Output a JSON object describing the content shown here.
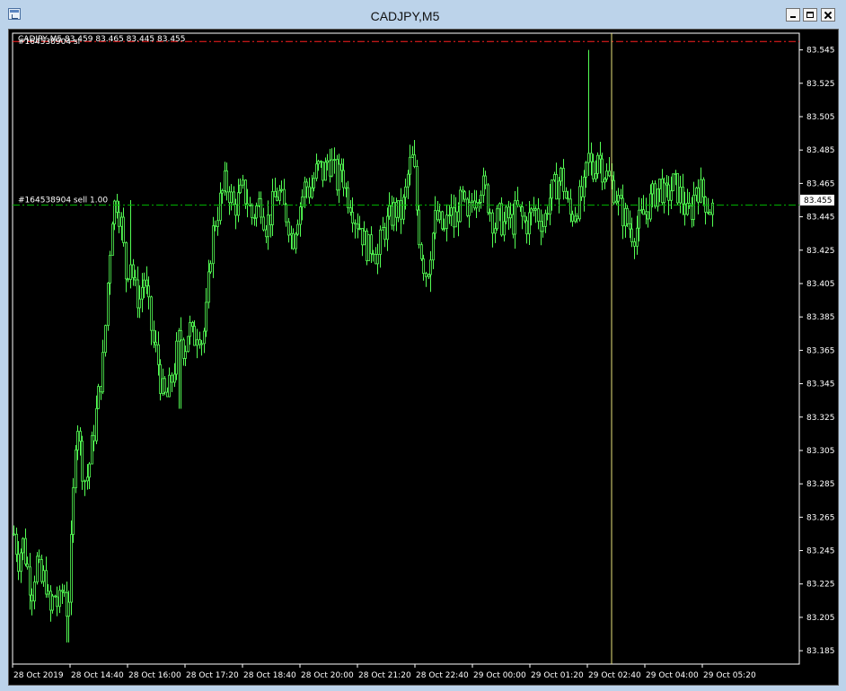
{
  "window": {
    "title": "CADJPY,M5",
    "icon": "chart-window-icon",
    "buttons": [
      "minimize-icon",
      "maximize-icon",
      "close-icon"
    ]
  },
  "chart_header": {
    "text": "CADJPY,M5  83.459 83.465 83.445 83.455",
    "overlap_text": "#164538904 sl"
  },
  "order_line": {
    "label": "#164538904 sell 1.00",
    "price": 83.452,
    "color": "#00b000"
  },
  "stop_loss_line": {
    "price": 83.55,
    "color": "#ff2020"
  },
  "current_price": {
    "label": "83.455",
    "price": 83.455
  },
  "colors": {
    "background": "#000000",
    "candle": "#54ff54",
    "grid_text": "#ffffff",
    "crosshair": "#e8e27a"
  },
  "chart_data": {
    "type": "candlestick",
    "symbol": "CADJPY",
    "timeframe": "M5",
    "y_ticks": [
      "83.545",
      "83.525",
      "83.505",
      "83.485",
      "83.465",
      "83.445",
      "83.425",
      "83.405",
      "83.385",
      "83.365",
      "83.345",
      "83.325",
      "83.305",
      "83.285",
      "83.265",
      "83.245",
      "83.225",
      "83.205",
      "83.185"
    ],
    "x_ticks": [
      "28 Oct 2019",
      "28 Oct 14:40",
      "28 Oct 16:00",
      "28 Oct 17:20",
      "28 Oct 18:40",
      "28 Oct 20:00",
      "28 Oct 21:20",
      "28 Oct 22:40",
      "29 Oct 00:00",
      "29 Oct 01:20",
      "29 Oct 02:40",
      "29 Oct 04:00",
      "29 Oct 05:20"
    ],
    "ylim": [
      83.177,
      83.555
    ],
    "vertical_line_time": "29 Oct 02:40",
    "price_path": [
      [
        0,
        83.255
      ],
      [
        5,
        83.24
      ],
      [
        10,
        83.25
      ],
      [
        15,
        83.235
      ],
      [
        20,
        83.22
      ],
      [
        25,
        83.24
      ],
      [
        30,
        83.225
      ],
      [
        35,
        83.23
      ],
      [
        40,
        83.205
      ],
      [
        45,
        83.22
      ],
      [
        50,
        83.21
      ],
      [
        55,
        83.225
      ],
      [
        60,
        83.205
      ],
      [
        65,
        83.26
      ],
      [
        70,
        83.33
      ],
      [
        75,
        83.3
      ],
      [
        80,
        83.285
      ],
      [
        85,
        83.3
      ],
      [
        90,
        83.32
      ],
      [
        95,
        83.34
      ],
      [
        100,
        83.36
      ],
      [
        105,
        83.41
      ],
      [
        110,
        83.45
      ],
      [
        115,
        83.455
      ],
      [
        120,
        83.44
      ],
      [
        125,
        83.41
      ],
      [
        130,
        83.42
      ],
      [
        135,
        83.4
      ],
      [
        140,
        83.395
      ],
      [
        145,
        83.41
      ],
      [
        150,
        83.39
      ],
      [
        155,
        83.37
      ],
      [
        160,
        83.36
      ],
      [
        165,
        83.34
      ],
      [
        170,
        83.335
      ],
      [
        175,
        83.345
      ],
      [
        180,
        83.36
      ],
      [
        185,
        83.375
      ],
      [
        190,
        83.365
      ],
      [
        195,
        83.38
      ],
      [
        200,
        83.37
      ],
      [
        205,
        83.38
      ],
      [
        210,
        83.37
      ],
      [
        215,
        83.39
      ],
      [
        220,
        83.43
      ],
      [
        225,
        83.445
      ],
      [
        230,
        83.455
      ],
      [
        235,
        83.465
      ],
      [
        240,
        83.46
      ],
      [
        245,
        83.45
      ],
      [
        250,
        83.455
      ],
      [
        255,
        83.46
      ],
      [
        260,
        83.455
      ],
      [
        265,
        83.445
      ],
      [
        270,
        83.45
      ],
      [
        275,
        83.455
      ],
      [
        280,
        83.44
      ],
      [
        285,
        83.445
      ],
      [
        290,
        83.455
      ],
      [
        295,
        83.46
      ],
      [
        300,
        83.45
      ],
      [
        305,
        83.445
      ],
      [
        310,
        83.43
      ],
      [
        315,
        83.445
      ],
      [
        320,
        83.455
      ],
      [
        325,
        83.465
      ],
      [
        330,
        83.46
      ],
      [
        335,
        83.47
      ],
      [
        340,
        83.475
      ],
      [
        345,
        83.47
      ],
      [
        350,
        83.48
      ],
      [
        355,
        83.475
      ],
      [
        360,
        83.465
      ],
      [
        365,
        83.475
      ],
      [
        370,
        83.46
      ],
      [
        375,
        83.455
      ],
      [
        380,
        83.445
      ],
      [
        385,
        83.44
      ],
      [
        390,
        83.43
      ],
      [
        395,
        83.425
      ],
      [
        400,
        83.43
      ],
      [
        405,
        83.42
      ],
      [
        410,
        83.435
      ],
      [
        415,
        83.44
      ],
      [
        420,
        83.445
      ],
      [
        425,
        83.45
      ],
      [
        430,
        83.445
      ],
      [
        435,
        83.455
      ],
      [
        440,
        83.475
      ],
      [
        445,
        83.48
      ],
      [
        450,
        83.44
      ],
      [
        455,
        83.42
      ],
      [
        460,
        83.41
      ],
      [
        465,
        83.43
      ],
      [
        470,
        83.445
      ],
      [
        475,
        83.44
      ],
      [
        480,
        83.435
      ],
      [
        485,
        83.45
      ],
      [
        490,
        83.44
      ],
      [
        495,
        83.45
      ],
      [
        500,
        83.455
      ],
      [
        505,
        83.44
      ],
      [
        510,
        83.455
      ],
      [
        515,
        83.46
      ],
      [
        520,
        83.465
      ],
      [
        525,
        83.46
      ],
      [
        530,
        83.45
      ],
      [
        535,
        83.44
      ],
      [
        540,
        83.445
      ],
      [
        545,
        83.44
      ],
      [
        550,
        83.445
      ],
      [
        555,
        83.44
      ],
      [
        560,
        83.45
      ],
      [
        565,
        83.445
      ],
      [
        570,
        83.44
      ],
      [
        575,
        83.445
      ],
      [
        580,
        83.45
      ],
      [
        585,
        83.445
      ],
      [
        590,
        83.44
      ],
      [
        595,
        83.455
      ],
      [
        600,
        83.46
      ],
      [
        605,
        83.465
      ],
      [
        610,
        83.47
      ],
      [
        615,
        83.455
      ],
      [
        620,
        83.445
      ],
      [
        625,
        83.45
      ],
      [
        630,
        83.455
      ],
      [
        635,
        83.46
      ],
      [
        640,
        83.48
      ],
      [
        645,
        83.47
      ],
      [
        650,
        83.485
      ],
      [
        655,
        83.475
      ],
      [
        660,
        83.47
      ],
      [
        665,
        83.465
      ],
      [
        670,
        83.46
      ],
      [
        675,
        83.45
      ],
      [
        680,
        83.445
      ],
      [
        685,
        83.44
      ],
      [
        690,
        83.435
      ],
      [
        695,
        83.44
      ],
      [
        700,
        83.445
      ],
      [
        705,
        83.45
      ],
      [
        710,
        83.455
      ],
      [
        715,
        83.46
      ],
      [
        720,
        83.465
      ],
      [
        725,
        83.455
      ],
      [
        730,
        83.46
      ],
      [
        735,
        83.465
      ],
      [
        740,
        83.46
      ],
      [
        745,
        83.455
      ],
      [
        750,
        83.445
      ],
      [
        755,
        83.45
      ],
      [
        760,
        83.465
      ],
      [
        765,
        83.46
      ],
      [
        770,
        83.455
      ],
      [
        775,
        83.45
      ]
    ],
    "spikes": [
      [
        640,
        83.545
      ],
      [
        465,
        83.4
      ],
      [
        60,
        83.19
      ],
      [
        130,
        83.455
      ],
      [
        185,
        83.33
      ]
    ]
  }
}
